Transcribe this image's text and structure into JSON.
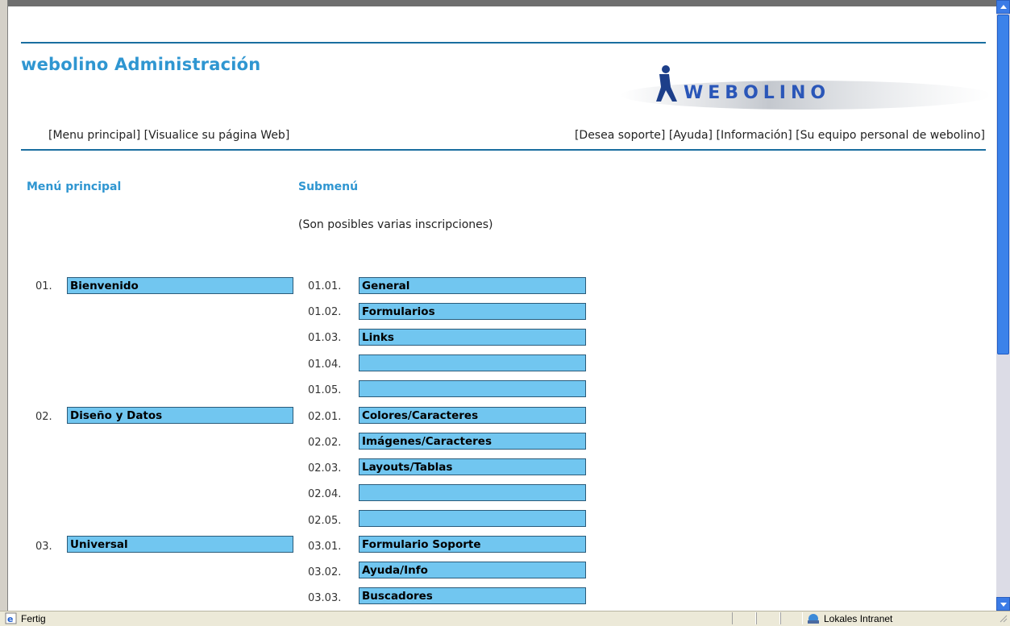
{
  "app": {
    "title": "webolino Administración",
    "logo_text": "WEBOLINO"
  },
  "nav": {
    "left": [
      "[Menu principal]",
      "[Visualice su página Web]"
    ],
    "right": [
      "[Desea soporte]",
      "[Ayuda]",
      "[Información]",
      "[Su equipo personal de webolino]"
    ]
  },
  "columns": {
    "main_header": "Menú principal",
    "sub_header": "Submenú",
    "note": "(Son posibles varias inscripciones)"
  },
  "main_items": [
    {
      "num": "01.",
      "label": "Bienvenido"
    },
    {
      "num": "02.",
      "label": "Diseño y Datos"
    },
    {
      "num": "03.",
      "label": "Universal"
    }
  ],
  "sub_items": [
    {
      "num": "01.01.",
      "label": "General"
    },
    {
      "num": "01.02.",
      "label": "Formularios"
    },
    {
      "num": "01.03.",
      "label": "Links"
    },
    {
      "num": "01.04.",
      "label": ""
    },
    {
      "num": "01.05.",
      "label": ""
    },
    {
      "num": "02.01.",
      "label": "Colores/Caracteres"
    },
    {
      "num": "02.02.",
      "label": "Imágenes/Caracteres"
    },
    {
      "num": "02.03.",
      "label": "Layouts/Tablas"
    },
    {
      "num": "02.04.",
      "label": ""
    },
    {
      "num": "02.05.",
      "label": ""
    },
    {
      "num": "03.01.",
      "label": "Formulario Soporte"
    },
    {
      "num": "03.02.",
      "label": "Ayuda/Info"
    },
    {
      "num": "03.03.",
      "label": "Buscadores"
    }
  ],
  "statusbar": {
    "status": "Fertig",
    "zone": "Lokales Intranet"
  },
  "colors": {
    "accent": "#2f96d1",
    "field_bg": "#71c6f0",
    "rule": "#1a6ea0"
  }
}
